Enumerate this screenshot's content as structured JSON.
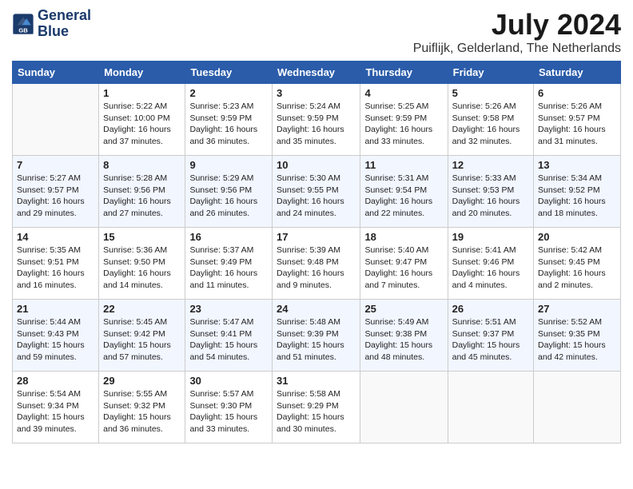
{
  "logo": {
    "line1": "General",
    "line2": "Blue"
  },
  "title": "July 2024",
  "location": "Puiflijk, Gelderland, The Netherlands",
  "days_of_week": [
    "Sunday",
    "Monday",
    "Tuesday",
    "Wednesday",
    "Thursday",
    "Friday",
    "Saturday"
  ],
  "weeks": [
    [
      {
        "day": "",
        "info": ""
      },
      {
        "day": "1",
        "info": "Sunrise: 5:22 AM\nSunset: 10:00 PM\nDaylight: 16 hours\nand 37 minutes."
      },
      {
        "day": "2",
        "info": "Sunrise: 5:23 AM\nSunset: 9:59 PM\nDaylight: 16 hours\nand 36 minutes."
      },
      {
        "day": "3",
        "info": "Sunrise: 5:24 AM\nSunset: 9:59 PM\nDaylight: 16 hours\nand 35 minutes."
      },
      {
        "day": "4",
        "info": "Sunrise: 5:25 AM\nSunset: 9:59 PM\nDaylight: 16 hours\nand 33 minutes."
      },
      {
        "day": "5",
        "info": "Sunrise: 5:26 AM\nSunset: 9:58 PM\nDaylight: 16 hours\nand 32 minutes."
      },
      {
        "day": "6",
        "info": "Sunrise: 5:26 AM\nSunset: 9:57 PM\nDaylight: 16 hours\nand 31 minutes."
      }
    ],
    [
      {
        "day": "7",
        "info": "Sunrise: 5:27 AM\nSunset: 9:57 PM\nDaylight: 16 hours\nand 29 minutes."
      },
      {
        "day": "8",
        "info": "Sunrise: 5:28 AM\nSunset: 9:56 PM\nDaylight: 16 hours\nand 27 minutes."
      },
      {
        "day": "9",
        "info": "Sunrise: 5:29 AM\nSunset: 9:56 PM\nDaylight: 16 hours\nand 26 minutes."
      },
      {
        "day": "10",
        "info": "Sunrise: 5:30 AM\nSunset: 9:55 PM\nDaylight: 16 hours\nand 24 minutes."
      },
      {
        "day": "11",
        "info": "Sunrise: 5:31 AM\nSunset: 9:54 PM\nDaylight: 16 hours\nand 22 minutes."
      },
      {
        "day": "12",
        "info": "Sunrise: 5:33 AM\nSunset: 9:53 PM\nDaylight: 16 hours\nand 20 minutes."
      },
      {
        "day": "13",
        "info": "Sunrise: 5:34 AM\nSunset: 9:52 PM\nDaylight: 16 hours\nand 18 minutes."
      }
    ],
    [
      {
        "day": "14",
        "info": "Sunrise: 5:35 AM\nSunset: 9:51 PM\nDaylight: 16 hours\nand 16 minutes."
      },
      {
        "day": "15",
        "info": "Sunrise: 5:36 AM\nSunset: 9:50 PM\nDaylight: 16 hours\nand 14 minutes."
      },
      {
        "day": "16",
        "info": "Sunrise: 5:37 AM\nSunset: 9:49 PM\nDaylight: 16 hours\nand 11 minutes."
      },
      {
        "day": "17",
        "info": "Sunrise: 5:39 AM\nSunset: 9:48 PM\nDaylight: 16 hours\nand 9 minutes."
      },
      {
        "day": "18",
        "info": "Sunrise: 5:40 AM\nSunset: 9:47 PM\nDaylight: 16 hours\nand 7 minutes."
      },
      {
        "day": "19",
        "info": "Sunrise: 5:41 AM\nSunset: 9:46 PM\nDaylight: 16 hours\nand 4 minutes."
      },
      {
        "day": "20",
        "info": "Sunrise: 5:42 AM\nSunset: 9:45 PM\nDaylight: 16 hours\nand 2 minutes."
      }
    ],
    [
      {
        "day": "21",
        "info": "Sunrise: 5:44 AM\nSunset: 9:43 PM\nDaylight: 15 hours\nand 59 minutes."
      },
      {
        "day": "22",
        "info": "Sunrise: 5:45 AM\nSunset: 9:42 PM\nDaylight: 15 hours\nand 57 minutes."
      },
      {
        "day": "23",
        "info": "Sunrise: 5:47 AM\nSunset: 9:41 PM\nDaylight: 15 hours\nand 54 minutes."
      },
      {
        "day": "24",
        "info": "Sunrise: 5:48 AM\nSunset: 9:39 PM\nDaylight: 15 hours\nand 51 minutes."
      },
      {
        "day": "25",
        "info": "Sunrise: 5:49 AM\nSunset: 9:38 PM\nDaylight: 15 hours\nand 48 minutes."
      },
      {
        "day": "26",
        "info": "Sunrise: 5:51 AM\nSunset: 9:37 PM\nDaylight: 15 hours\nand 45 minutes."
      },
      {
        "day": "27",
        "info": "Sunrise: 5:52 AM\nSunset: 9:35 PM\nDaylight: 15 hours\nand 42 minutes."
      }
    ],
    [
      {
        "day": "28",
        "info": "Sunrise: 5:54 AM\nSunset: 9:34 PM\nDaylight: 15 hours\nand 39 minutes."
      },
      {
        "day": "29",
        "info": "Sunrise: 5:55 AM\nSunset: 9:32 PM\nDaylight: 15 hours\nand 36 minutes."
      },
      {
        "day": "30",
        "info": "Sunrise: 5:57 AM\nSunset: 9:30 PM\nDaylight: 15 hours\nand 33 minutes."
      },
      {
        "day": "31",
        "info": "Sunrise: 5:58 AM\nSunset: 9:29 PM\nDaylight: 15 hours\nand 30 minutes."
      },
      {
        "day": "",
        "info": ""
      },
      {
        "day": "",
        "info": ""
      },
      {
        "day": "",
        "info": ""
      }
    ]
  ]
}
